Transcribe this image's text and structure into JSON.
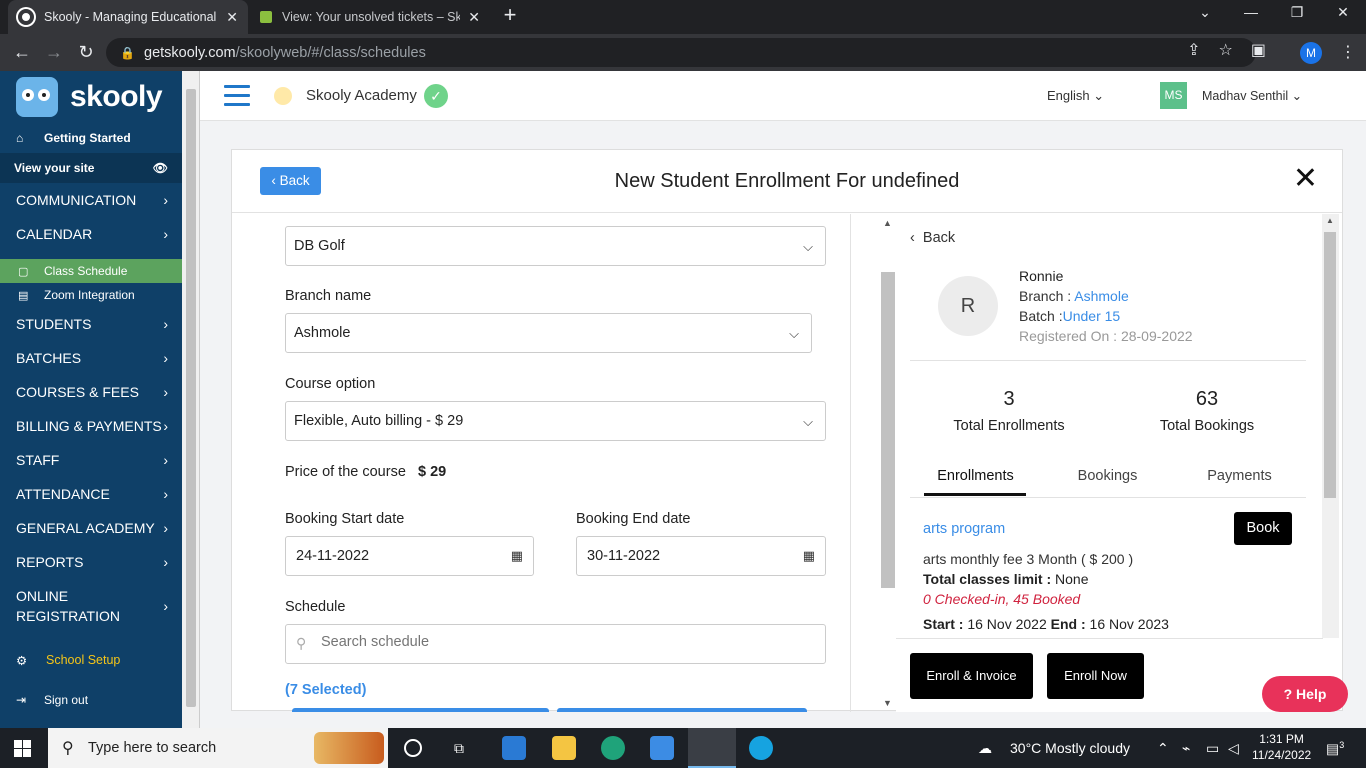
{
  "browser": {
    "tabs": [
      {
        "title": "Skooly - Managing Educational Institutions",
        "active": true
      },
      {
        "title": "View: Your unsolved tickets – Skooly",
        "active": false
      }
    ],
    "url_host": "getskooly.com",
    "url_path": "/skoolyweb/#/class/schedules",
    "profile_initial": "M"
  },
  "sidebar": {
    "brand": "skooly",
    "getting_started": "Getting Started",
    "view_site": "View your site",
    "items": [
      {
        "label": "COMMUNICATION"
      },
      {
        "label": "CALENDAR"
      }
    ],
    "sub_items": [
      {
        "label": "Class Schedule",
        "active": true
      },
      {
        "label": "Zoom Integration",
        "active": false
      }
    ],
    "items2": [
      {
        "label": "STUDENTS"
      },
      {
        "label": "BATCHES"
      },
      {
        "label": "COURSES & FEES"
      },
      {
        "label": "BILLING & PAYMENTS"
      },
      {
        "label": "STAFF"
      },
      {
        "label": "ATTENDANCE"
      },
      {
        "label": "GENERAL ACADEMY"
      },
      {
        "label": "REPORTS"
      },
      {
        "label": "ONLINE REGISTRATION"
      }
    ],
    "school_setup": "School Setup",
    "sign_out": "Sign out"
  },
  "header": {
    "academy": "Skooly Academy",
    "language": "English",
    "user_initials": "MS",
    "user_name": "Madhav Senthil"
  },
  "modal": {
    "back": "Back",
    "title": "New Student Enrollment For undefined",
    "course_value": "DB Golf",
    "branch_label": "Branch name",
    "branch_value": "Ashmole",
    "option_label": "Course option",
    "option_value": "Flexible, Auto billing - $ 29",
    "price_label": "Price of the course",
    "price_value": "$ 29",
    "start_label": "Booking Start date",
    "start_value": "24-11-2022",
    "end_label": "Booking End date",
    "end_value": "30-11-2022",
    "schedule_label": "Schedule",
    "schedule_placeholder": "Search schedule",
    "selected": "(7 Selected)"
  },
  "student": {
    "back": "Back",
    "initial": "R",
    "name": "Ronnie",
    "branch_label": "Branch : ",
    "branch": "Ashmole",
    "batch_label": "Batch :",
    "batch": "Under 15",
    "registered": "Registered On : 28-09-2022",
    "total_enrollments": "3",
    "total_enrollments_label": "Total Enrollments",
    "total_bookings": "63",
    "total_bookings_label": "Total Bookings",
    "tabs": [
      "Enrollments",
      "Bookings",
      "Payments"
    ],
    "program": {
      "name": "arts program",
      "book": "Book",
      "fee": "arts monthly fee 3 Month ( $ 200 )",
      "limit_label": "Total classes limit : ",
      "limit": "None",
      "status": "0 Checked-in, 45 Booked",
      "start_label": "Start : ",
      "start": "16 Nov 2022",
      "end_label": " End : ",
      "end": "16 Nov 2023"
    },
    "enroll_invoice": "Enroll & Invoice",
    "enroll_now": "Enroll Now"
  },
  "help": "Help",
  "taskbar": {
    "search": "Type here to search",
    "weather": "30°C  Mostly cloudy",
    "time": "1:31 PM",
    "date": "11/24/2022",
    "notif": "3"
  }
}
